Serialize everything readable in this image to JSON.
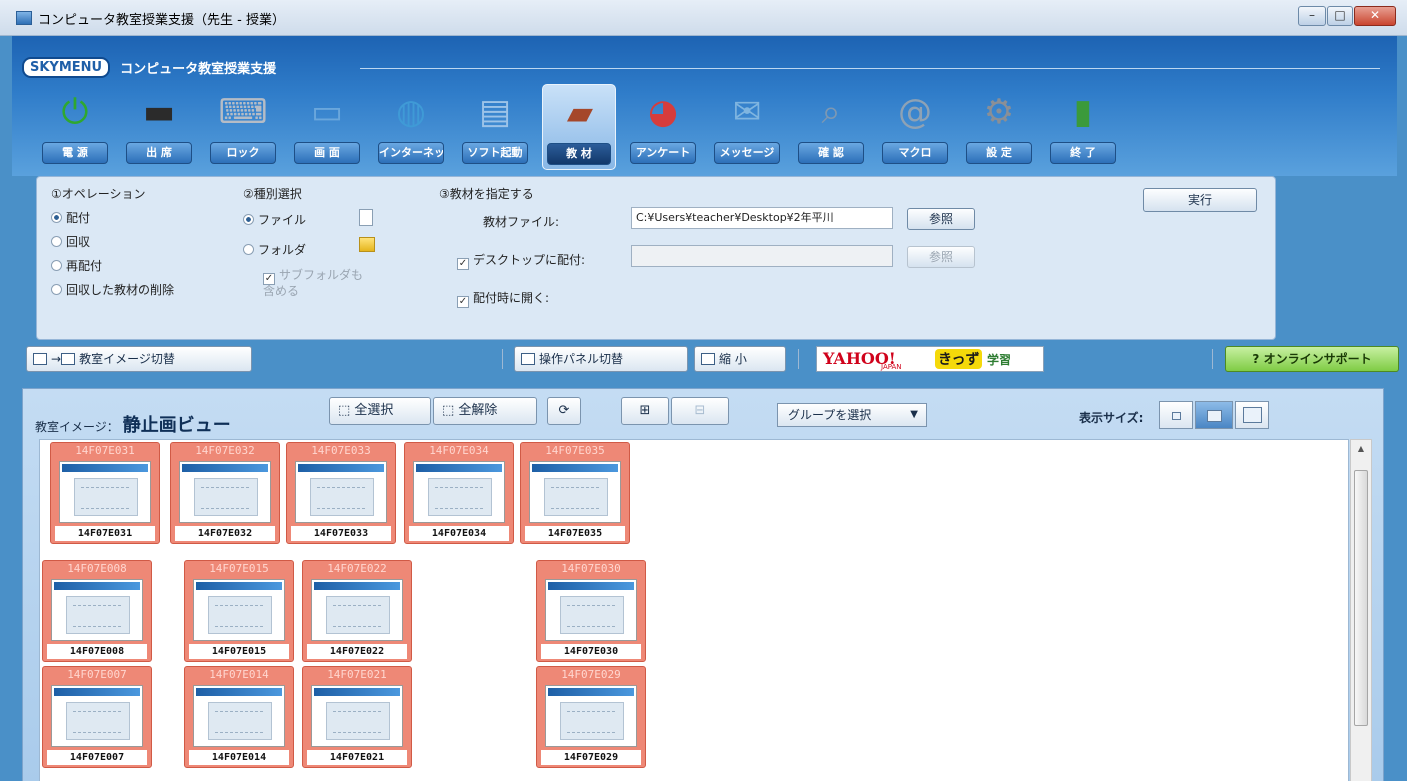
{
  "window": {
    "title": "コンピュータ教室授業支援（先生 - 授業）",
    "min_label": "–",
    "max_label": "□",
    "close_label": "✕"
  },
  "brand": {
    "logo": "SKYMENU",
    "subtitle": "コンピュータ教室授業支援"
  },
  "tools": [
    {
      "label": "電 源",
      "icon": "power-icon",
      "glyph": "⏻",
      "color": "#2fa82f"
    },
    {
      "label": "出 席",
      "icon": "attendance-book-icon",
      "glyph": "▬",
      "color": "#2b2b2b"
    },
    {
      "label": "ロック",
      "icon": "lock-keyboard-icon",
      "glyph": "⌨",
      "color": "#b5bcc6"
    },
    {
      "label": "画 面",
      "icon": "monitor-icon",
      "glyph": "▭",
      "color": "#6aa7dc"
    },
    {
      "label": "インターネット",
      "icon": "globe-icon",
      "glyph": "◍",
      "color": "#3f9ad6"
    },
    {
      "label": "ソフト起動",
      "icon": "software-launch-icon",
      "glyph": "▤",
      "color": "#9cc3e8"
    },
    {
      "label": "教 材",
      "icon": "teaching-material-book-icon",
      "glyph": "▰",
      "color": "#a5472a"
    },
    {
      "label": "アンケート",
      "icon": "pie-chart-icon",
      "glyph": "◕",
      "color": "#d63c3c"
    },
    {
      "label": "メッセージ",
      "icon": "message-envelope-icon",
      "glyph": "✉",
      "color": "#7fb5e0"
    },
    {
      "label": "確 認",
      "icon": "magnifier-icon",
      "glyph": "⌕",
      "color": "#7d98b3"
    },
    {
      "label": "マクロ",
      "icon": "macro-at-icon",
      "glyph": "@",
      "color": "#8ea2b5"
    },
    {
      "label": "設 定",
      "icon": "gear-icon",
      "glyph": "⚙",
      "color": "#8a8f96"
    },
    {
      "label": "終 了",
      "icon": "exit-door-icon",
      "glyph": "▮",
      "color": "#3b9a3b"
    }
  ],
  "active_tool": "教 材",
  "options": {
    "operation": {
      "title": "①オペレーション",
      "items": [
        "配付",
        "回収",
        "再配付",
        "回収した教材の削除"
      ],
      "selected": "配付"
    },
    "type": {
      "title": "②種別選択",
      "file": "ファイル",
      "folder": "フォルダ",
      "include_sub": "サブフォルダも\n含める",
      "selected": "ファイル"
    },
    "material": {
      "title": "③教材を指定する",
      "file_label": "教材ファイル:",
      "file_value": "C:¥Users¥teacher¥Desktop¥2年平川",
      "browse": "参照",
      "desktop_label": "デスクトップに配付:",
      "desktop_value": "",
      "browse2": "参照",
      "open_label": "配付時に開く:"
    },
    "execute": "実行"
  },
  "toolbar2": {
    "switch_image": "教室イメージ切替",
    "panel_switch": "操作パネル切替",
    "shrink": "縮 小",
    "yahoo_logo": "YAHOO!",
    "yahoo_japan": "JAPAN",
    "kids": "きっず",
    "study": "学習",
    "support": "オンラインサポート"
  },
  "classroom": {
    "label": "教室イメージ：",
    "view": "静止画ビュー",
    "select_all": "全選択",
    "deselect_all": "全解除",
    "group_select": "グループを選択",
    "size_label": "表示サイズ:"
  },
  "pcs": [
    {
      "id": "14F07E031"
    },
    {
      "id": "14F07E032"
    },
    {
      "id": "14F07E033"
    },
    {
      "id": "14F07E034"
    },
    {
      "id": "14F07E035"
    },
    {
      "id": "14F07E008"
    },
    {
      "id": "14F07E015"
    },
    {
      "id": "14F07E022"
    },
    {
      "id": "14F07E030"
    },
    {
      "id": "14F07E007"
    },
    {
      "id": "14F07E014"
    },
    {
      "id": "14F07E021"
    },
    {
      "id": "14F07E029"
    }
  ]
}
